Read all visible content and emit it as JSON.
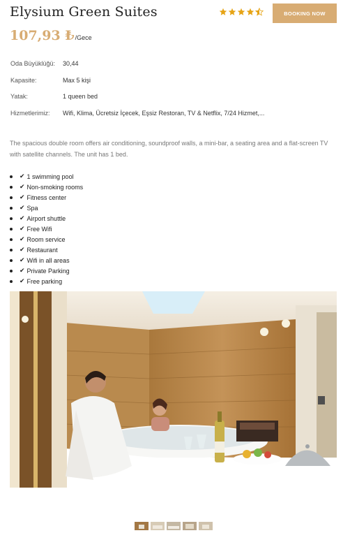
{
  "hotel": {
    "name": "Elysium Green Suites",
    "rating": 4.5,
    "book_label": "BOOKING NOW",
    "price": "107,93 ₺",
    "per_night": "/Gece"
  },
  "details": [
    {
      "label": "Oda Büyüklüğü:",
      "value": "30,44"
    },
    {
      "label": "Kapasite:",
      "value": "Max 5 kişi"
    },
    {
      "label": "Yatak:",
      "value": "1 queen bed"
    },
    {
      "label": "Hizmetlerimiz:",
      "value": "Wifi, Klima, Ücretsiz İçecek, Eşsiz Restoran, TV & Netflix, 7/24 Hizmet,..."
    }
  ],
  "description": "The spacious double room offers air conditioning, soundproof walls, a mini-bar, a seating area and a flat-screen TV with satellite channels. The unit has 1 bed.",
  "amenities": [
    "1 swimming pool",
    "Non-smoking rooms",
    "Fitness center",
    "Spa",
    "Airport shuttle",
    "Free Wifi",
    "Room service",
    "Restaurant",
    "Wifi in all areas",
    "Private Parking",
    "Free parking"
  ],
  "gallery": {
    "thumbnail_count": 5
  },
  "colors": {
    "accent": "#d8ac73",
    "text": "#333333",
    "muted": "#777777"
  }
}
